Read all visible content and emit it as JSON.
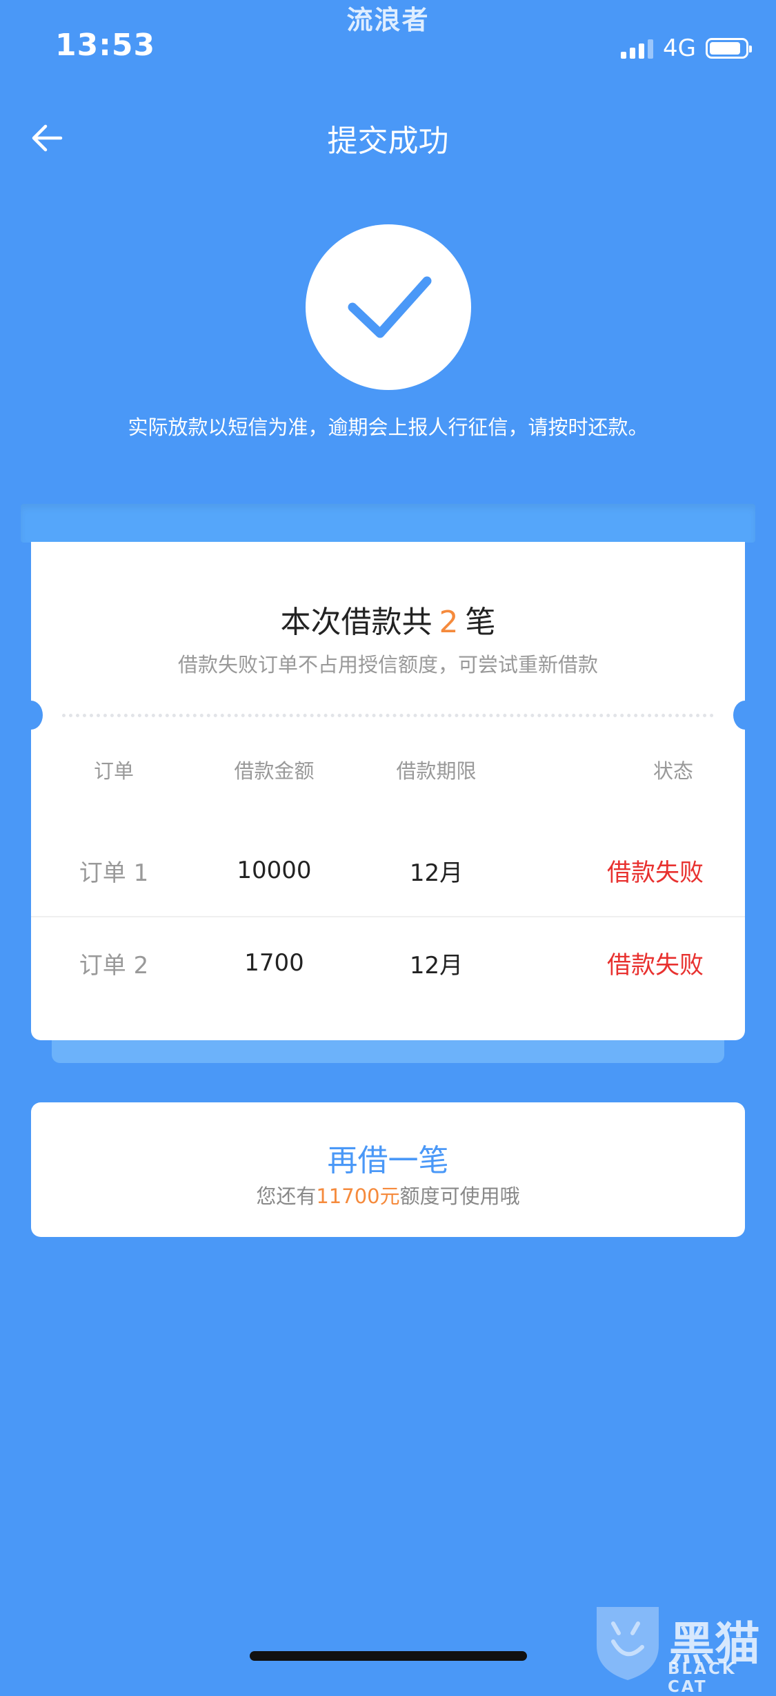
{
  "status_bar": {
    "time": "13:53",
    "network": "4G"
  },
  "watermark_top": "流浪者",
  "nav": {
    "title": "提交成功"
  },
  "notice": "实际放款以短信为准，逾期会上报人行征信，请按时还款。",
  "summary": {
    "prefix": "本次借款共",
    "count": "2",
    "suffix": "笔",
    "hint": "借款失败订单不占用授信额度，可尝试重新借款"
  },
  "table": {
    "headers": [
      "订单",
      "借款金额",
      "借款期限",
      "状态"
    ],
    "rows": [
      {
        "order": "订单 1",
        "amount": "10000",
        "term": "12月",
        "status": "借款失败"
      },
      {
        "order": "订单 2",
        "amount": "1700",
        "term": "12月",
        "status": "借款失败"
      }
    ]
  },
  "borrow_again": {
    "label": "再借一笔",
    "sub_prefix": "您还有",
    "amount": "11700元",
    "sub_suffix": "额度可使用哦"
  },
  "watermark_logo": {
    "name": "黑猫",
    "sub": "BLACK CAT"
  },
  "colors": {
    "background": "#4A98F7",
    "accent_orange": "#F58A3C",
    "fail_red": "#E8312F"
  }
}
